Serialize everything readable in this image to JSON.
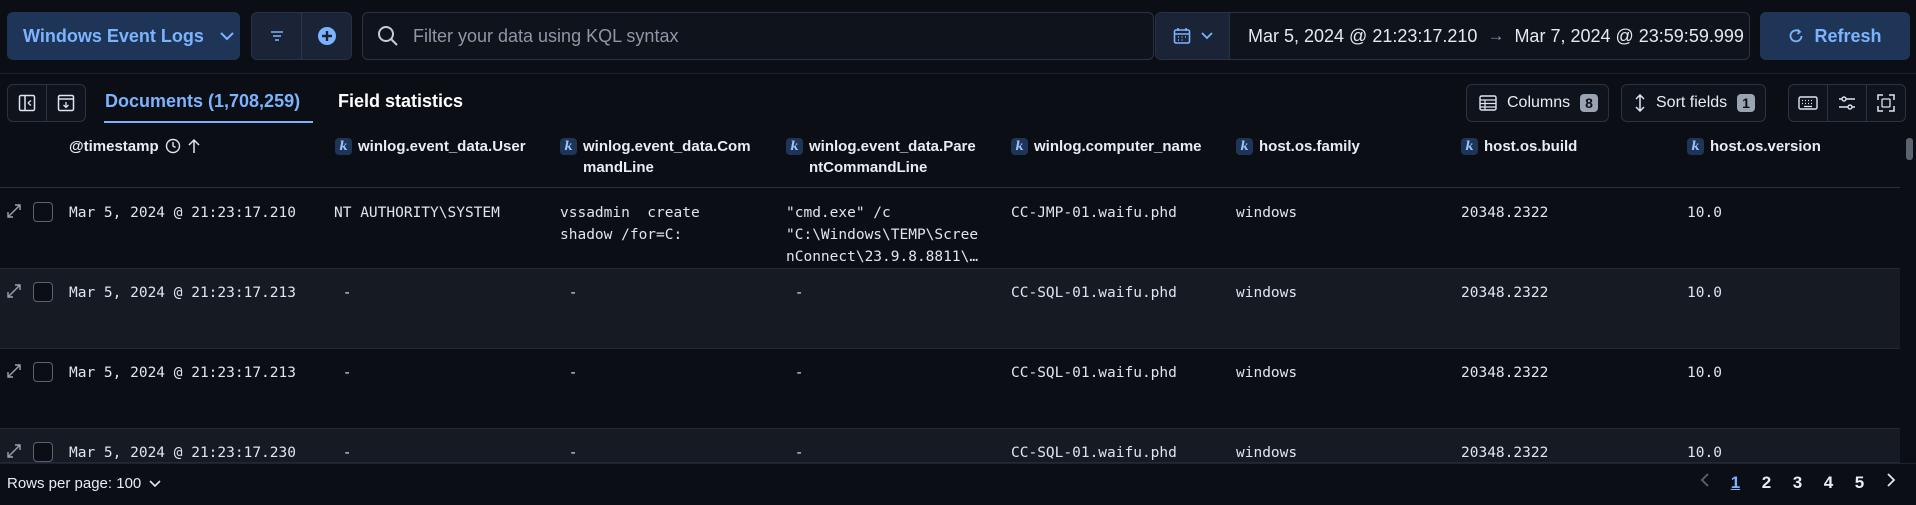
{
  "top": {
    "data_view_label": "Windows Event Logs",
    "search_placeholder": "Filter your data using KQL syntax",
    "start_date": "Mar 5, 2024 @ 21:23:17.210",
    "end_date": "Mar 7, 2024 @ 23:59:59.999",
    "refresh_label": "Refresh"
  },
  "tabs": {
    "documents": "Documents (1,708,259)",
    "field_statistics": "Field statistics"
  },
  "toolbar": {
    "columns_label": "Columns",
    "columns_count": "8",
    "sort_label": "Sort fields",
    "sort_count": "1"
  },
  "columns": {
    "timestamp": "@timestamp",
    "user": "winlog.event_data.User",
    "cmdline_a": "winlog.event_data.Com",
    "cmdline_b": "mandLine",
    "parent_a": "winlog.event_data.Pare",
    "parent_b": "ntCommandLine",
    "computer": "winlog.computer_name",
    "family": "host.os.family",
    "build": "host.os.build",
    "version": "host.os.version",
    "type_badge": "k"
  },
  "rows": [
    {
      "timestamp": "Mar 5, 2024 @ 21:23:17.210",
      "user": "NT AUTHORITY\\SYSTEM",
      "cmdline": "vssadmin  create\nshadow /for=C:",
      "parent": "\"cmd.exe\" /c\n\"C:\\Windows\\TEMP\\Scree\nnConnect\\23.9.8.8811\\…",
      "computer": "CC-JMP-01.waifu.phd",
      "family": "windows",
      "build": "20348.2322",
      "version": "10.0"
    },
    {
      "timestamp": "Mar 5, 2024 @ 21:23:17.213",
      "user": " -",
      "cmdline": " -",
      "parent": " -",
      "computer": "CC-SQL-01.waifu.phd",
      "family": "windows",
      "build": "20348.2322",
      "version": "10.0"
    },
    {
      "timestamp": "Mar 5, 2024 @ 21:23:17.213",
      "user": " -",
      "cmdline": " -",
      "parent": " -",
      "computer": "CC-SQL-01.waifu.phd",
      "family": "windows",
      "build": "20348.2322",
      "version": "10.0"
    },
    {
      "timestamp": "Mar 5, 2024 @ 21:23:17.230",
      "user": " -",
      "cmdline": " -",
      "parent": " -",
      "computer": "CC-SQL-01.waifu.phd",
      "family": "windows",
      "build": "20348.2322",
      "version": "10.0"
    }
  ],
  "footer": {
    "rows_per_page": "Rows per page: 100",
    "pages": [
      "1",
      "2",
      "3",
      "4",
      "5"
    ],
    "current_page": "1"
  },
  "icons": {
    "accent": "#7cb3ff",
    "accent_bg": "#1f3557"
  }
}
